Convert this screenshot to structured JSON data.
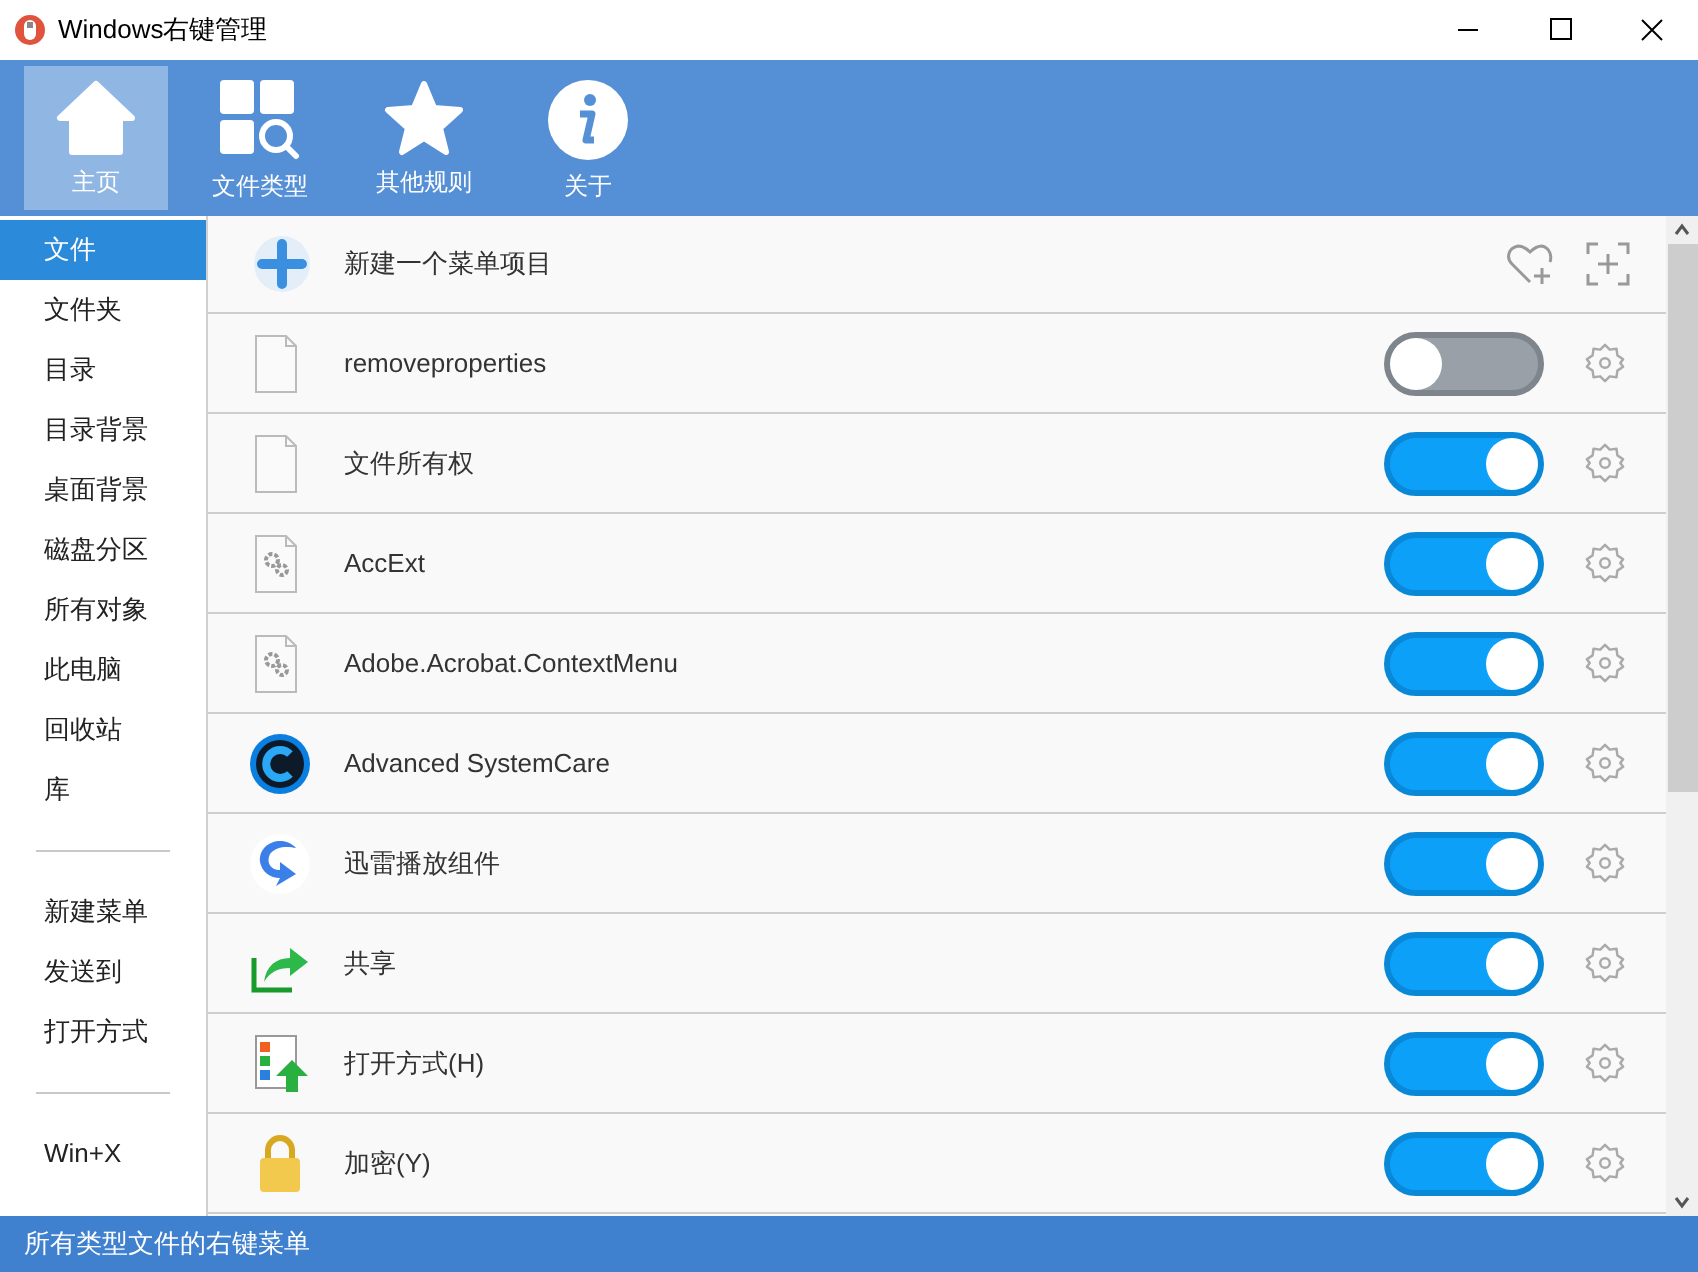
{
  "window": {
    "title": "Windows右键管理"
  },
  "toolbar": [
    {
      "label": "主页",
      "selected": true
    },
    {
      "label": "文件类型",
      "selected": false
    },
    {
      "label": "其他规则",
      "selected": false
    },
    {
      "label": "关于",
      "selected": false
    }
  ],
  "sidebar": {
    "groups": [
      [
        {
          "label": "文件",
          "selected": true
        },
        {
          "label": "文件夹",
          "selected": false
        },
        {
          "label": "目录",
          "selected": false
        },
        {
          "label": "目录背景",
          "selected": false
        },
        {
          "label": "桌面背景",
          "selected": false
        },
        {
          "label": "磁盘分区",
          "selected": false
        },
        {
          "label": "所有对象",
          "selected": false
        },
        {
          "label": "此电脑",
          "selected": false
        },
        {
          "label": "回收站",
          "selected": false
        },
        {
          "label": "库",
          "selected": false
        }
      ],
      [
        {
          "label": "新建菜单",
          "selected": false
        },
        {
          "label": "发送到",
          "selected": false
        },
        {
          "label": "打开方式",
          "selected": false
        }
      ],
      [
        {
          "label": "Win+X",
          "selected": false
        }
      ]
    ]
  },
  "new_item": {
    "label": "新建一个菜单项目"
  },
  "items": [
    {
      "kind": "blank",
      "label": "removeproperties",
      "on": false
    },
    {
      "kind": "blank",
      "label": "文件所有权",
      "on": true
    },
    {
      "kind": "gear",
      "label": "AccExt",
      "on": true
    },
    {
      "kind": "gear",
      "label": "Adobe.Acrobat.ContextMenu",
      "on": true
    },
    {
      "kind": "disc",
      "label": "Advanced SystemCare",
      "on": true
    },
    {
      "kind": "swirl",
      "label": "迅雷播放组件",
      "on": true
    },
    {
      "kind": "share",
      "label": "共享",
      "on": true
    },
    {
      "kind": "openwith",
      "label": "打开方式(H)",
      "on": true
    },
    {
      "kind": "lock",
      "label": "加密(Y)",
      "on": true
    }
  ],
  "status_bar": "所有类型文件的右键菜单"
}
